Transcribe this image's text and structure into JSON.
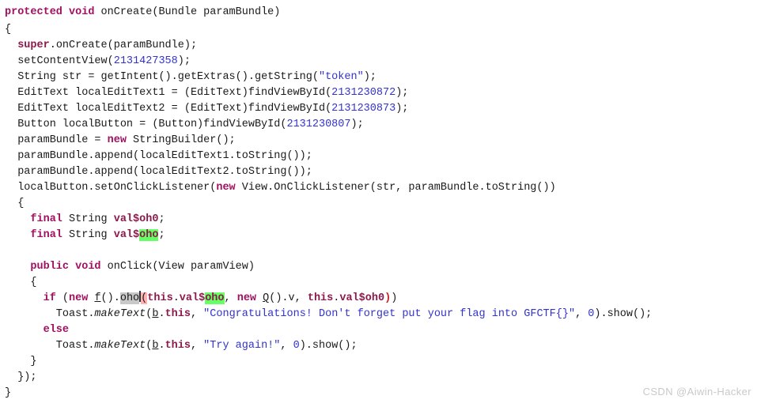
{
  "window": {
    "title": "Decompiled Java Source",
    "background_color": "#ffffff"
  },
  "theme": {
    "keyword_color": "#a01060",
    "number_color": "#3333cc",
    "string_color": "#3333cc",
    "text_color": "#1a1a1a",
    "search_highlight_color": "#66ff66",
    "selection_highlight_color": "#c8c8c8",
    "paren_match_color": "#ffb3b3",
    "watermark_color": "#c9c9c9"
  },
  "code": {
    "language": "java",
    "lines": [
      "protected void onCreate(Bundle paramBundle)",
      "{",
      "  super.onCreate(paramBundle);",
      "  setContentView(2131427358);",
      "  String str = getIntent().getExtras().getString(\"token\");",
      "  EditText localEditText1 = (EditText)findViewById(2131230872);",
      "  EditText localEditText2 = (EditText)findViewById(2131230873);",
      "  Button localButton = (Button)findViewById(2131230807);",
      "  paramBundle = new StringBuilder();",
      "  paramBundle.append(localEditText1.toString());",
      "  paramBundle.append(localEditText2.toString());",
      "  localButton.setOnClickListener(new View.OnClickListener(str, paramBundle.toString())",
      "  {",
      "    final String val$oh0;",
      "    final String val$oho;",
      "",
      "    public void onClick(View paramView)",
      "    {",
      "      if (new f().oho(this.val$oho, new Q().v, this.val$oh0))",
      "        Toast.makeText(b.this, \"Congratulations! Don't forget put your flag into GFCTF{}\", 0).show();",
      "      else",
      "        Toast.makeText(b.this, \"Try again!\", 0).show();",
      "    }",
      "  });",
      "}"
    ],
    "tokens": {
      "keywords": [
        "protected",
        "void",
        "new",
        "final",
        "public",
        "if",
        "else"
      ],
      "literals_numeric": [
        "2131427358",
        "2131230872",
        "2131230873",
        "2131230807",
        "0"
      ],
      "literals_string": [
        "\"token\"",
        "\"Congratulations! Don't forget put your flag into GFCTF{}\"",
        "\"Try again!\""
      ],
      "highlighted_search_term": "oho",
      "selected_term": "oho",
      "underlined_identifiers": [
        "f",
        "Q",
        "b"
      ],
      "italic_identifiers": [
        "makeText"
      ]
    }
  },
  "watermark": {
    "text": "CSDN @Aiwin-Hacker"
  }
}
